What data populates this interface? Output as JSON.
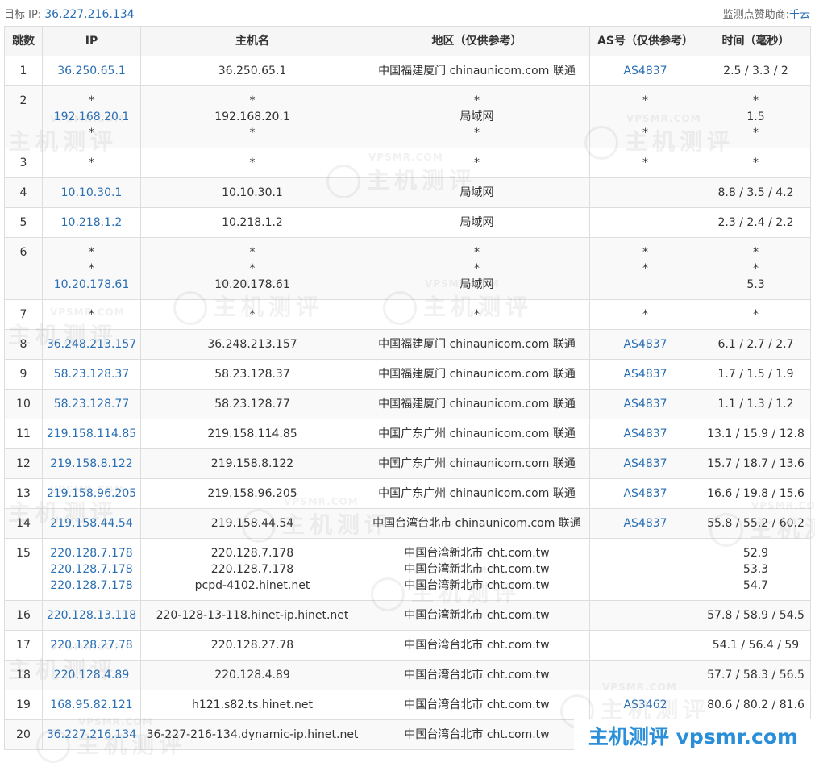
{
  "header": {
    "target_label": "目标 IP:",
    "target_ip": "36.227.216.134",
    "sponsor_label": "监测点赞助商:",
    "sponsor": "千云"
  },
  "columns": [
    "跳数",
    "IP",
    "主机名",
    "地区（仅供参考）",
    "AS号（仅供参考）",
    "时间（毫秒）"
  ],
  "hops": [
    {
      "hop": "1",
      "ip": [
        "36.250.65.1"
      ],
      "host": [
        "36.250.65.1"
      ],
      "region": [
        "中国福建厦门 chinaunicom.com 联通"
      ],
      "asn": [
        "AS4837"
      ],
      "time": [
        "2.5 / 3.3 / 2"
      ]
    },
    {
      "hop": "2",
      "ip": [
        "*",
        "192.168.20.1",
        "*"
      ],
      "host": [
        "*",
        "192.168.20.1",
        "*"
      ],
      "region": [
        "*",
        "局域网",
        "*"
      ],
      "asn": [
        "*",
        "",
        "*"
      ],
      "time": [
        "*",
        "1.5",
        "*"
      ]
    },
    {
      "hop": "3",
      "ip": [
        "*"
      ],
      "host": [
        "*"
      ],
      "region": [
        "*"
      ],
      "asn": [
        "*"
      ],
      "time": [
        "*"
      ]
    },
    {
      "hop": "4",
      "ip": [
        "10.10.30.1"
      ],
      "host": [
        "10.10.30.1"
      ],
      "region": [
        "局域网"
      ],
      "asn": [
        ""
      ],
      "time": [
        "8.8 / 3.5 / 4.2"
      ]
    },
    {
      "hop": "5",
      "ip": [
        "10.218.1.2"
      ],
      "host": [
        "10.218.1.2"
      ],
      "region": [
        "局域网"
      ],
      "asn": [
        ""
      ],
      "time": [
        "2.3 / 2.4 / 2.2"
      ]
    },
    {
      "hop": "6",
      "ip": [
        "*",
        "*",
        "10.20.178.61"
      ],
      "host": [
        "*",
        "*",
        "10.20.178.61"
      ],
      "region": [
        "*",
        "*",
        "局域网"
      ],
      "asn": [
        "*",
        "*",
        ""
      ],
      "time": [
        "*",
        "*",
        "5.3"
      ]
    },
    {
      "hop": "7",
      "ip": [
        "*"
      ],
      "host": [
        "*"
      ],
      "region": [
        "*"
      ],
      "asn": [
        "*"
      ],
      "time": [
        "*"
      ]
    },
    {
      "hop": "8",
      "ip": [
        "36.248.213.157"
      ],
      "host": [
        "36.248.213.157"
      ],
      "region": [
        "中国福建厦门 chinaunicom.com 联通"
      ],
      "asn": [
        "AS4837"
      ],
      "time": [
        "6.1 / 2.7 / 2.7"
      ]
    },
    {
      "hop": "9",
      "ip": [
        "58.23.128.37"
      ],
      "host": [
        "58.23.128.37"
      ],
      "region": [
        "中国福建厦门 chinaunicom.com 联通"
      ],
      "asn": [
        "AS4837"
      ],
      "time": [
        "1.7 / 1.5 / 1.9"
      ]
    },
    {
      "hop": "10",
      "ip": [
        "58.23.128.77"
      ],
      "host": [
        "58.23.128.77"
      ],
      "region": [
        "中国福建厦门 chinaunicom.com 联通"
      ],
      "asn": [
        "AS4837"
      ],
      "time": [
        "1.1 / 1.3 / 1.2"
      ]
    },
    {
      "hop": "11",
      "ip": [
        "219.158.114.85"
      ],
      "host": [
        "219.158.114.85"
      ],
      "region": [
        "中国广东广州 chinaunicom.com 联通"
      ],
      "asn": [
        "AS4837"
      ],
      "time": [
        "13.1 / 15.9 / 12.8"
      ]
    },
    {
      "hop": "12",
      "ip": [
        "219.158.8.122"
      ],
      "host": [
        "219.158.8.122"
      ],
      "region": [
        "中国广东广州 chinaunicom.com 联通"
      ],
      "asn": [
        "AS4837"
      ],
      "time": [
        "15.7 / 18.7 / 13.6"
      ]
    },
    {
      "hop": "13",
      "ip": [
        "219.158.96.205"
      ],
      "host": [
        "219.158.96.205"
      ],
      "region": [
        "中国广东广州 chinaunicom.com 联通"
      ],
      "asn": [
        "AS4837"
      ],
      "time": [
        "16.6 / 19.8 / 15.6"
      ]
    },
    {
      "hop": "14",
      "ip": [
        "219.158.44.54"
      ],
      "host": [
        "219.158.44.54"
      ],
      "region": [
        "中国台湾台北市 chinaunicom.com 联通"
      ],
      "asn": [
        "AS4837"
      ],
      "time": [
        "55.8 / 55.2 / 60.2"
      ]
    },
    {
      "hop": "15",
      "ip": [
        "220.128.7.178",
        "220.128.7.178",
        "220.128.7.178"
      ],
      "host": [
        "220.128.7.178",
        "220.128.7.178",
        "pcpd-4102.hinet.net"
      ],
      "region": [
        "中国台湾新北市 cht.com.tw",
        "中国台湾新北市 cht.com.tw",
        "中国台湾新北市 cht.com.tw"
      ],
      "asn": [
        "",
        "",
        ""
      ],
      "time": [
        "52.9",
        "53.3",
        "54.7"
      ]
    },
    {
      "hop": "16",
      "ip": [
        "220.128.13.118"
      ],
      "host": [
        "220-128-13-118.hinet-ip.hinet.net"
      ],
      "region": [
        "中国台湾新北市 cht.com.tw"
      ],
      "asn": [
        ""
      ],
      "time": [
        "57.8 / 58.9 / 54.5"
      ]
    },
    {
      "hop": "17",
      "ip": [
        "220.128.27.78"
      ],
      "host": [
        "220.128.27.78"
      ],
      "region": [
        "中国台湾台北市 cht.com.tw"
      ],
      "asn": [
        ""
      ],
      "time": [
        "54.1 / 56.4 / 59"
      ]
    },
    {
      "hop": "18",
      "ip": [
        "220.128.4.89"
      ],
      "host": [
        "220.128.4.89"
      ],
      "region": [
        "中国台湾台北市 cht.com.tw"
      ],
      "asn": [
        ""
      ],
      "time": [
        "57.7 / 58.3 / 56.5"
      ]
    },
    {
      "hop": "19",
      "ip": [
        "168.95.82.121"
      ],
      "host": [
        "h121.s82.ts.hinet.net"
      ],
      "region": [
        "中国台湾台北市 cht.com.tw"
      ],
      "asn": [
        "AS3462"
      ],
      "time": [
        "80.6 / 80.2 / 81.6"
      ]
    },
    {
      "hop": "20",
      "ip": [
        "36.227.216.134"
      ],
      "host": [
        "36-227-216-134.dynamic-ip.hinet.net"
      ],
      "region": [
        "中国台湾台北市 cht.com.tw"
      ],
      "asn": [
        ""
      ],
      "time": [
        ""
      ]
    }
  ],
  "watermark": {
    "small": "VPSMR.COM",
    "big": "主机测评"
  },
  "brand": "主机测评 vpsmr.com",
  "colors": {
    "link": "#2a6fb4",
    "brand": "#2a8fd8",
    "border": "#dddddd",
    "header_bg": "#f6f6f6"
  }
}
